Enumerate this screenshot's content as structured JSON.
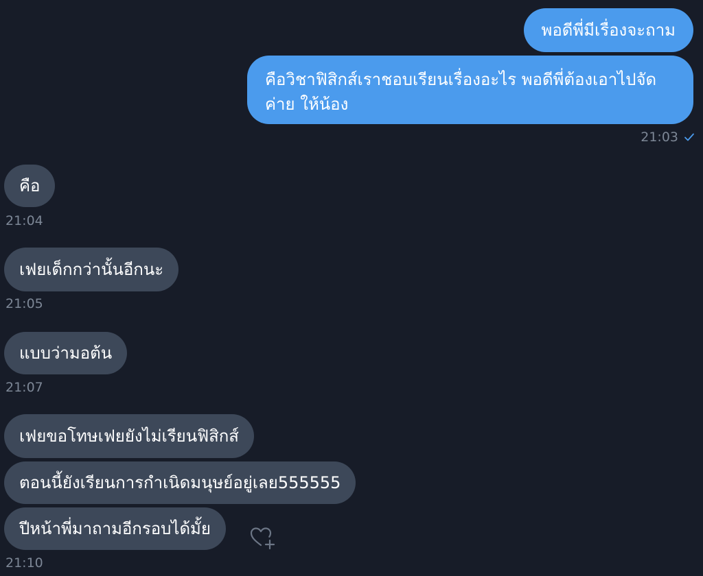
{
  "conversation": {
    "sent": [
      {
        "text": "พอดีพี่มีเรื่องจะถาม"
      },
      {
        "text": "คือวิชาฟิสิกส์เราชอบเรียนเรื่องอะไร พอดีพี่ต้องเอาไปจัดค่าย ให้น้อง"
      }
    ],
    "sent_time": "21:03",
    "received": [
      {
        "text": "คือ",
        "time": "21:04"
      },
      {
        "text": "เฟยเด็กกว่านั้นอีกนะ",
        "time": "21:05"
      },
      {
        "text": "แบบว่ามอต้น",
        "time": "21:07"
      }
    ],
    "received_group": {
      "messages": [
        {
          "text": "เฟยขอโทษเฟยยังไม่เรียนฟิสิกส์"
        },
        {
          "text": "ตอนนี้ยังเรียนการกำเนิดมนุษย์อยู่เลย555555"
        },
        {
          "text": "ปีหน้าพี่มาถามอีกรอบได้มั้ย"
        }
      ],
      "time": "21:10"
    }
  },
  "icons": {
    "read_receipt": "checkmark-icon",
    "react": "heart-plus-icon"
  },
  "colors": {
    "background": "#171c28",
    "outgoing_bubble": "#4b9bed",
    "incoming_bubble": "#3d4859",
    "timestamp": "#7d8796"
  }
}
